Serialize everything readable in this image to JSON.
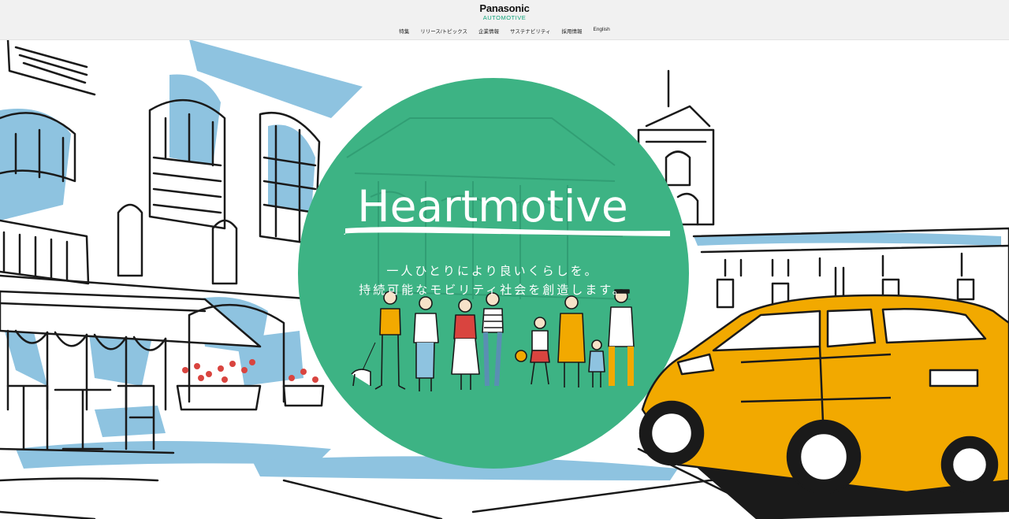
{
  "header": {
    "logo_main": "Panasonic",
    "logo_sub": "AUTOMOTIVE",
    "nav": [
      {
        "label": "特集"
      },
      {
        "label": "リリース/トピックス"
      },
      {
        "label": "企業情報"
      },
      {
        "label": "サステナビリティ"
      },
      {
        "label": "採用情報"
      },
      {
        "label": "English"
      }
    ]
  },
  "hero": {
    "title": "Heartmotive",
    "tagline_line1": "一人ひとりにより良いくらしを。",
    "tagline_line2": "持続可能なモビリティ社会を創造します。"
  },
  "colors": {
    "circle_green": "#3db384",
    "sky_blue": "#8ec3e0",
    "car_yellow": "#f2a900",
    "line_black": "#1a1a1a",
    "flower_red": "#d9443f"
  }
}
